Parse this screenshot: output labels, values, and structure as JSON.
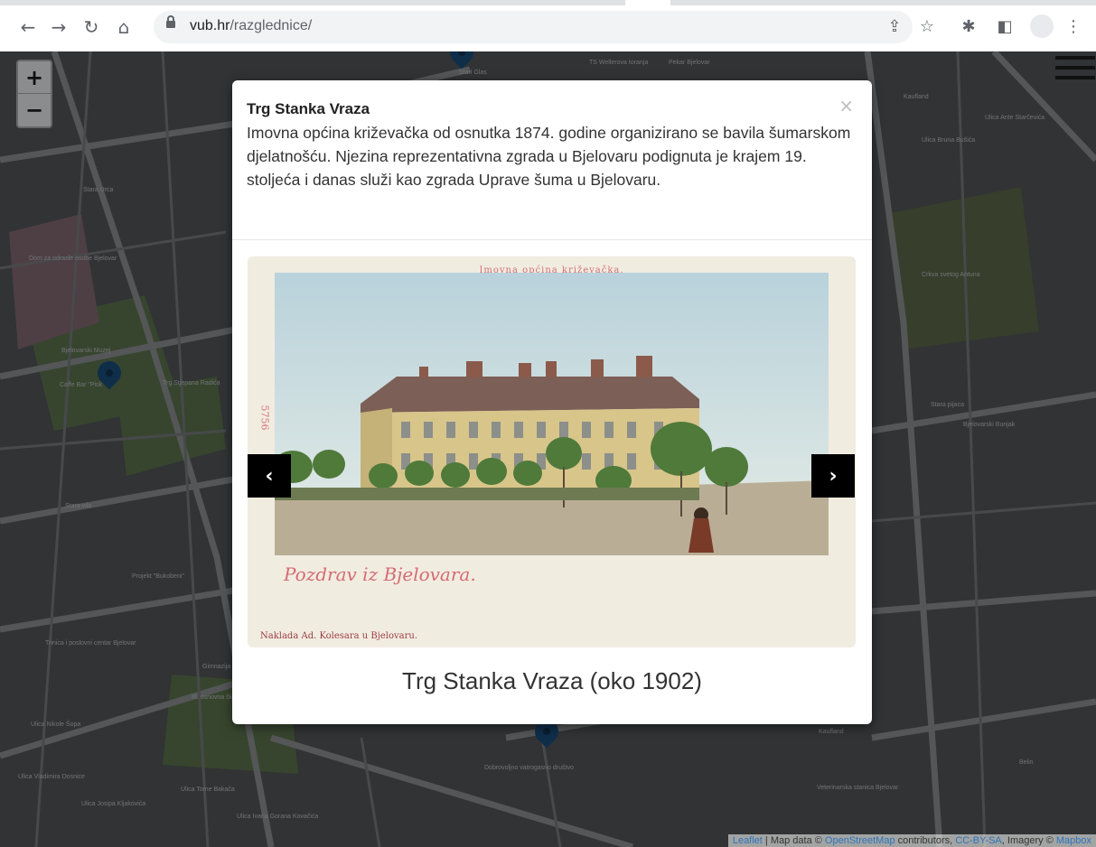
{
  "browser": {
    "url_domain": "vub.hr",
    "url_path": "/razglednice/",
    "icons": {
      "back": "arrow-left-icon",
      "forward": "arrow-right-icon",
      "reload": "reload-icon",
      "home": "home-icon",
      "share": "share-icon",
      "bookmark": "star-icon",
      "extensions": "puzzle-icon",
      "sidepanel": "side-panel-icon",
      "profile": "avatar",
      "menu": "kebab-menu-icon"
    }
  },
  "map": {
    "zoom_in_label": "+",
    "zoom_out_label": "−",
    "labels": [
      "Stari Glas",
      "TS Wellerova toranja",
      "Pekar Bjelovar",
      "Stara Urca",
      "Dom za odrasle osobe Bjelovar",
      "Bjelovarski Muzej",
      "Caffe Bar \"Pisk",
      "Trg Stjepana Radića",
      "Stara vila",
      "Projekt \"Bukobeni\"",
      "Trinica i poslovni centar Bjelovar",
      "III. osnovna škola Bjelovar",
      "Ulica Nikole Šopa",
      "Ulica Vladimira Dosnice",
      "Ulica Josipa Kljakovića",
      "Ulica Tome Bakača",
      "Gimnazija",
      "Kaufland",
      "Veterinarska stanica Bjelovar",
      "Crkva svetog Antuna",
      "Stara pijaca",
      "Bjelovarski Bunjak",
      "Ulica Bruna Bušića",
      "Kaufland",
      "Ulica Ante Starčevića",
      "Belin",
      "Dobrovoljno vatrogasno društvo",
      "Ulica Ivana Gorana Kovačića"
    ],
    "menu_icon": "hamburger-menu-icon",
    "marker_icon": "map-marker-icon",
    "attribution": {
      "leaflet": "Leaflet",
      "sep1": " | Map data © ",
      "osm": "OpenStreetMap",
      "sep2": " contributors, ",
      "license": "CC-BY-SA",
      "sep3": ", Imagery © ",
      "mapbox": "Mapbox"
    }
  },
  "modal": {
    "title": "Trg Stanka Vraza",
    "close": "×",
    "description": "Imovna općina križevačka od osnutka 1874. godine organizirano se bavila šumarskom djelatnošću. Njezina reprezentativna zgrada u Bjelovaru podignuta je krajem 19. stoljeća i danas služi kao zgrada Uprave šuma u Bjelovaru.",
    "prev": "‹",
    "next": "›",
    "caption": "Trg Stanka Vraza (oko 1902)",
    "postcard": {
      "header": "Imovna općina križevačka.",
      "greeting": "Pozdrav iz Bjelovara.",
      "footer": "Naklada Ad. Kolesara u Bjelovaru.",
      "number": "5756"
    }
  }
}
